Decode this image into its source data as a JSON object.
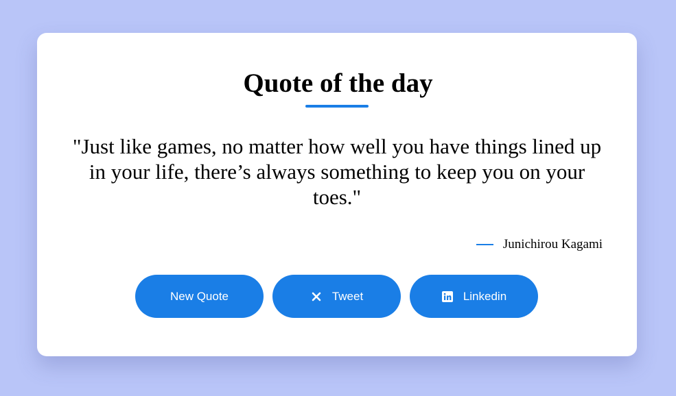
{
  "colors": {
    "background": "#b9c5f8",
    "accent": "#1a7ee6",
    "card": "#ffffff"
  },
  "card": {
    "title": "Quote of the day",
    "quote": "\"Just like games, no matter how well you have things lined up in your life, there’s always something to keep you on your toes.\"",
    "author": "Junichirou Kagami"
  },
  "buttons": {
    "new_quote": {
      "label": "New Quote"
    },
    "tweet": {
      "label": "Tweet",
      "icon": "x-icon"
    },
    "linkedin": {
      "label": "Linkedin",
      "icon": "linkedin-icon"
    }
  }
}
